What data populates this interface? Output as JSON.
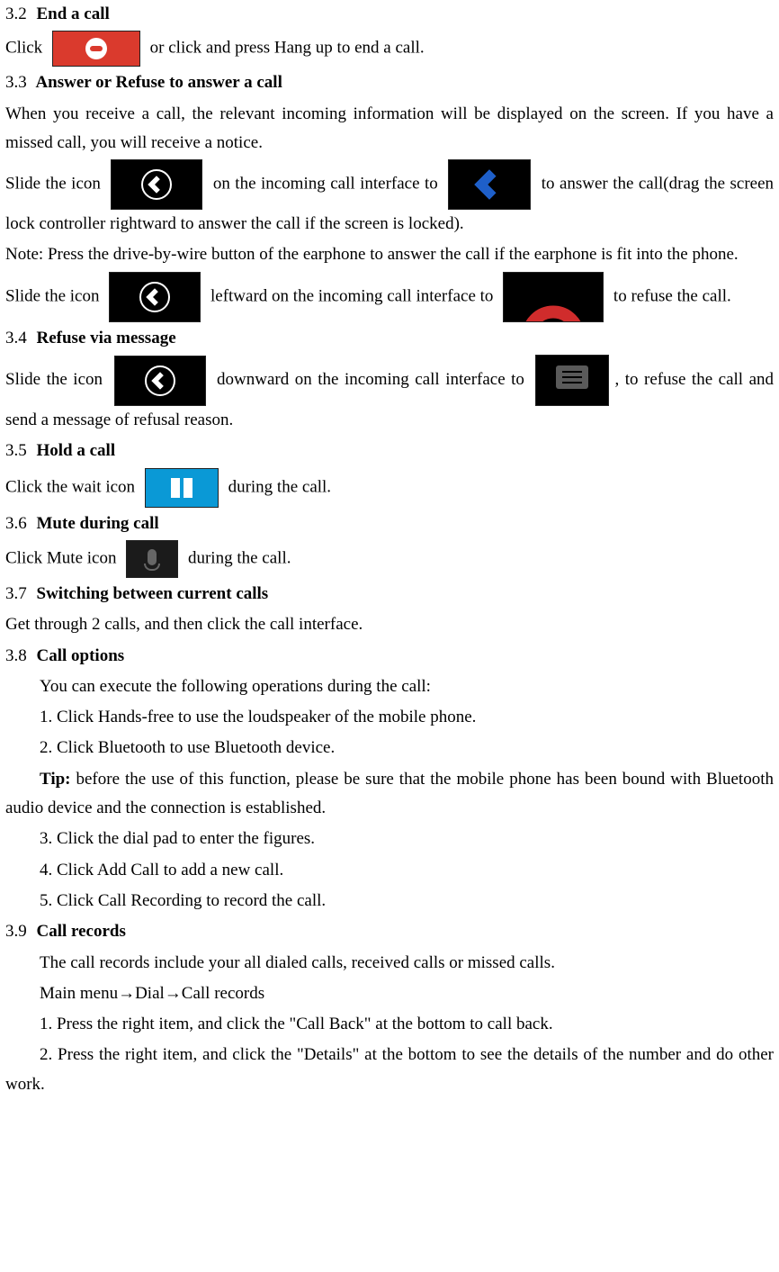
{
  "s32": {
    "num": "3.2",
    "title": "End a call",
    "pre": "Click",
    "post": "or click and press Hang up to end a call."
  },
  "s33": {
    "num": "3.3",
    "title": "Answer or Refuse to answer a call",
    "p1": "When you receive a call, the relevant incoming information will be displayed on the screen. If you have a missed call, you will receive a notice.",
    "slidePre": "Slide the icon",
    "ansMid": "on the incoming call interface to",
    "ansPost": "to answer the call(drag the screen lock controller rightward to answer the call if the screen is locked).",
    "note": "Note: Press the drive-by-wire button of the earphone to answer the call if the earphone is fit into the phone.",
    "refMid": "leftward on the incoming call interface to",
    "refPost": "to refuse the call."
  },
  "s34": {
    "num": "3.4",
    "title": "Refuse via message",
    "pre": "Slide the icon",
    "mid": "downward on the incoming call interface to",
    "post": ", to refuse the call and send a message of refusal reason."
  },
  "s35": {
    "num": "3.5",
    "title": "Hold a call",
    "pre": "Click the wait icon",
    "post": "during the call."
  },
  "s36": {
    "num": "3.6",
    "title": "Mute during call",
    "pre": "Click Mute icon",
    "post": "during the call."
  },
  "s37": {
    "num": "3.7",
    "title": "Switching between current calls",
    "body": "Get through 2 calls, and then click the call interface."
  },
  "s38": {
    "num": "3.8",
    "title": "Call options",
    "intro": "You can execute the following operations during the call:",
    "i1": "1. Click Hands-free to use the loudspeaker of the mobile phone.",
    "i2": "2. Click Bluetooth to use Bluetooth device.",
    "tipLabel": "Tip:",
    "tipBody": " before the use of this function, please be sure that the mobile phone has been bound with Bluetooth audio device and the connection is established.",
    "i3": "3. Click the dial pad to enter the figures.",
    "i4": "4. Click Add Call to add a new call.",
    "i5": "5. Click Call Recording to record the call."
  },
  "s39": {
    "num": "3.9",
    "title": "Call records",
    "p1": "The call records include your all dialed calls, received calls or missed calls.",
    "p2": "Main menu→Dial→Call records",
    "i1": "1. Press the right item, and click the \"Call Back\" at the bottom to call back.",
    "i2": "2. Press the right item, and click the \"Details\" at the bottom to see the details of the number and do other work."
  }
}
